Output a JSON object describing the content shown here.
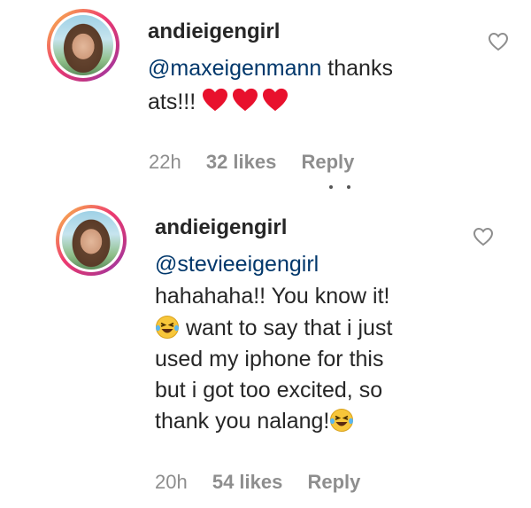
{
  "comments": [
    {
      "username": "andieigengirl",
      "lines": [
        "@maxeigenmann",
        "thanks",
        "ats!!!"
      ],
      "time": "22h",
      "likes": "32 likes",
      "reply": "Reply"
    },
    {
      "username": "andieigengirl",
      "lines": [
        "@stevieeigengirl",
        "hahahaha!! You know it!",
        "want to say that i just",
        "used my iphone for this",
        "but i got too excited, so",
        "thank you nalang!"
      ],
      "time": "20h",
      "likes": "54 likes",
      "reply": "Reply"
    }
  ],
  "icons": {
    "like": "heart-outline-icon",
    "heart_emoji": "red-heart-emoji",
    "laugh_emoji": "tears-of-joy-emoji"
  },
  "colors": {
    "mention": "#00376b",
    "text": "#262626",
    "meta": "#8e8e8e",
    "heart": "#e8112d"
  }
}
